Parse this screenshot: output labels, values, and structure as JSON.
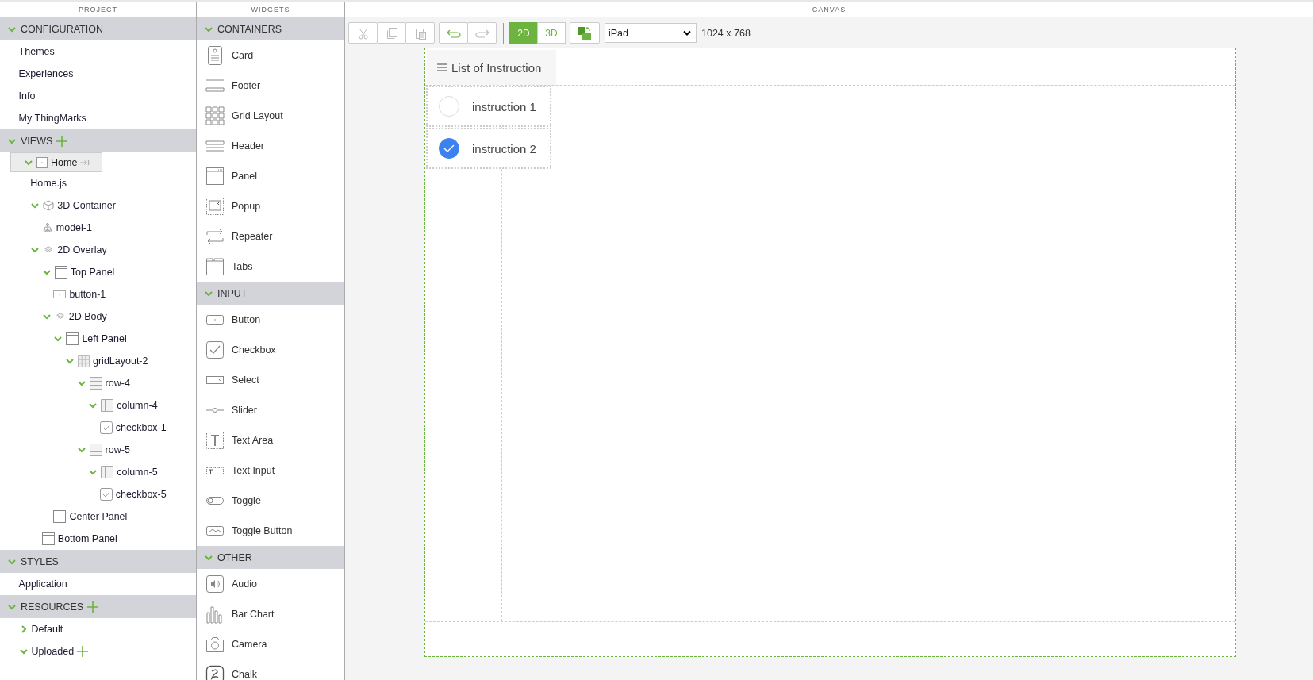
{
  "project": {
    "title": "PROJECT",
    "sections": [
      {
        "label": "CONFIGURATION",
        "expanded": true,
        "addable": false,
        "items": [
          {
            "label": "Themes"
          },
          {
            "label": "Experiences"
          },
          {
            "label": "Info"
          },
          {
            "label": "My ThingMarks"
          }
        ]
      },
      {
        "label": "VIEWS",
        "expanded": true,
        "addable": true,
        "items": [
          {
            "label": "Home",
            "kind": "view",
            "expanded": true,
            "selected": true,
            "children": [
              {
                "label": "Home.js",
                "selected": false
              },
              {
                "label": "3D Container",
                "kind": "cube",
                "expanded": true,
                "selected": false,
                "children": [
                  {
                    "label": "model-1",
                    "kind": "model",
                    "selected": false
                  }
                ]
              },
              {
                "label": "2D Overlay",
                "kind": "layers",
                "expanded": true,
                "selected": false,
                "children": [
                  {
                    "label": "Top Panel",
                    "kind": "panel",
                    "expanded": true,
                    "selected": false,
                    "children": [
                      {
                        "label": "button-1",
                        "kind": "button",
                        "selected": false
                      }
                    ]
                  },
                  {
                    "label": "2D Body",
                    "kind": "layers",
                    "expanded": true,
                    "selected": false,
                    "children": [
                      {
                        "label": "Left Panel",
                        "kind": "panel",
                        "expanded": true,
                        "selected": false,
                        "children": [
                          {
                            "label": "gridLayout-2",
                            "kind": "grid",
                            "expanded": true,
                            "selected": false,
                            "children": [
                              {
                                "label": "row-4",
                                "kind": "row",
                                "expanded": true,
                                "selected": false,
                                "children": [
                                  {
                                    "label": "column-4",
                                    "kind": "column",
                                    "expanded": true,
                                    "selected": false,
                                    "children": [
                                      {
                                        "label": "checkbox-1",
                                        "kind": "checkbox",
                                        "selected": false
                                      }
                                    ]
                                  }
                                ]
                              },
                              {
                                "label": "row-5",
                                "kind": "row",
                                "expanded": true,
                                "selected": false,
                                "children": [
                                  {
                                    "label": "column-5",
                                    "kind": "column",
                                    "expanded": true,
                                    "selected": false,
                                    "children": [
                                      {
                                        "label": "checkbox-5",
                                        "kind": "checkbox",
                                        "selected": false
                                      }
                                    ]
                                  }
                                ]
                              }
                            ]
                          }
                        ]
                      },
                      {
                        "label": "Center Panel",
                        "kind": "panel",
                        "selected": false
                      }
                    ]
                  },
                  {
                    "label": "Bottom Panel",
                    "kind": "panel",
                    "selected": false
                  }
                ]
              }
            ]
          }
        ]
      },
      {
        "label": "STYLES",
        "expanded": true,
        "addable": false,
        "items": [
          {
            "label": "Application"
          }
        ]
      },
      {
        "label": "RESOURCES",
        "expanded": true,
        "addable": true,
        "items": [
          {
            "label": "Default",
            "expanded": false,
            "addable": false
          },
          {
            "label": "Uploaded",
            "expanded": true,
            "addable": true
          }
        ]
      }
    ]
  },
  "widgets": {
    "title": "WIDGETS",
    "sections": [
      {
        "label": "CONTAINERS",
        "expanded": true,
        "items": [
          {
            "label": "Card",
            "kind": "card"
          },
          {
            "label": "Footer",
            "kind": "footer"
          },
          {
            "label": "Grid Layout",
            "kind": "grid"
          },
          {
            "label": "Header",
            "kind": "header"
          },
          {
            "label": "Panel",
            "kind": "panel"
          },
          {
            "label": "Popup",
            "kind": "popup"
          },
          {
            "label": "Repeater",
            "kind": "repeater"
          },
          {
            "label": "Tabs",
            "kind": "tabs"
          }
        ]
      },
      {
        "label": "INPUT",
        "expanded": true,
        "items": [
          {
            "label": "Button",
            "kind": "button"
          },
          {
            "label": "Checkbox",
            "kind": "checkbox"
          },
          {
            "label": "Select",
            "kind": "select"
          },
          {
            "label": "Slider",
            "kind": "slider"
          },
          {
            "label": "Text Area",
            "kind": "textarea"
          },
          {
            "label": "Text Input",
            "kind": "textinput"
          },
          {
            "label": "Toggle",
            "kind": "toggle"
          },
          {
            "label": "Toggle Button",
            "kind": "togglebutton"
          }
        ]
      },
      {
        "label": "OTHER",
        "expanded": true,
        "items": [
          {
            "label": "Audio",
            "kind": "audio"
          },
          {
            "label": "Bar Chart",
            "kind": "barchart"
          },
          {
            "label": "Camera",
            "kind": "camera"
          },
          {
            "label": "Chalk",
            "kind": "chalk"
          }
        ]
      }
    ]
  },
  "canvas": {
    "title": "CANVAS",
    "toolbar": {
      "edit_buttons": [
        {
          "kind": "cut",
          "disabled": true
        },
        {
          "kind": "copy",
          "disabled": true
        },
        {
          "kind": "paste",
          "disabled": true
        }
      ],
      "history_buttons": [
        {
          "kind": "undo",
          "disabled": false
        },
        {
          "kind": "redo",
          "disabled": true
        }
      ],
      "modes": [
        {
          "label": "2D",
          "selected": true
        },
        {
          "label": "3D",
          "selected": false
        }
      ],
      "device": "iPad",
      "resolution": "1024 x 768"
    },
    "preview": {
      "title": "List of Instruction",
      "items": [
        {
          "label": "instruction 1",
          "checked": false
        },
        {
          "label": "instruction 2",
          "checked": true
        }
      ]
    }
  }
}
